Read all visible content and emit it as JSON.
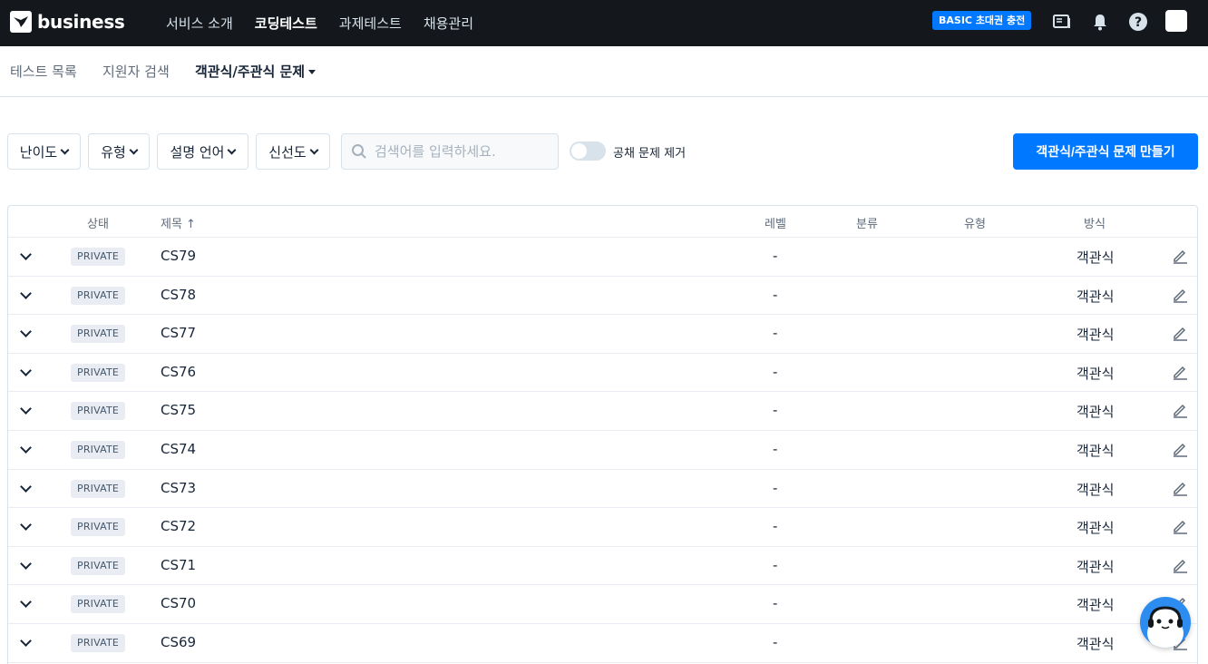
{
  "brand": {
    "name": "business"
  },
  "nav": {
    "links": [
      "서비스 소개",
      "코딩테스트",
      "과제테스트",
      "채용관리"
    ],
    "active_index": 1,
    "badge": "BASIC 초대권 충전",
    "icons": [
      "document-icon",
      "bell-icon",
      "help-icon",
      "avatar"
    ]
  },
  "subnav": {
    "items": [
      "테스트 목록",
      "지원자 검색",
      "객관식/주관식 문제"
    ],
    "active_index": 2
  },
  "filters": {
    "difficulty": "난이도",
    "type": "유형",
    "language": "설명 언어",
    "freshness": "신선도",
    "search_placeholder": "검색어를 입력하세요.",
    "toggle_label": "공채 문제 제거",
    "create_button": "객관식/주관식 문제 만들기"
  },
  "table": {
    "headers": {
      "status": "상태",
      "title": "제목 ↑",
      "level": "레벨",
      "category": "분류",
      "type": "유형",
      "method": "방식"
    },
    "rows": [
      {
        "status": "PRIVATE",
        "title": "CS79",
        "level": "-",
        "method": "객관식"
      },
      {
        "status": "PRIVATE",
        "title": "CS78",
        "level": "-",
        "method": "객관식"
      },
      {
        "status": "PRIVATE",
        "title": "CS77",
        "level": "-",
        "method": "객관식"
      },
      {
        "status": "PRIVATE",
        "title": "CS76",
        "level": "-",
        "method": "객관식"
      },
      {
        "status": "PRIVATE",
        "title": "CS75",
        "level": "-",
        "method": "객관식"
      },
      {
        "status": "PRIVATE",
        "title": "CS74",
        "level": "-",
        "method": "객관식"
      },
      {
        "status": "PRIVATE",
        "title": "CS73",
        "level": "-",
        "method": "객관식"
      },
      {
        "status": "PRIVATE",
        "title": "CS72",
        "level": "-",
        "method": "객관식"
      },
      {
        "status": "PRIVATE",
        "title": "CS71",
        "level": "-",
        "method": "객관식"
      },
      {
        "status": "PRIVATE",
        "title": "CS70",
        "level": "-",
        "method": "객관식"
      },
      {
        "status": "PRIVATE",
        "title": "CS69",
        "level": "-",
        "method": "객관식"
      }
    ]
  },
  "colors": {
    "primary": "#0078ff",
    "nav_bg": "#14171c",
    "border": "#d7e2eb"
  }
}
